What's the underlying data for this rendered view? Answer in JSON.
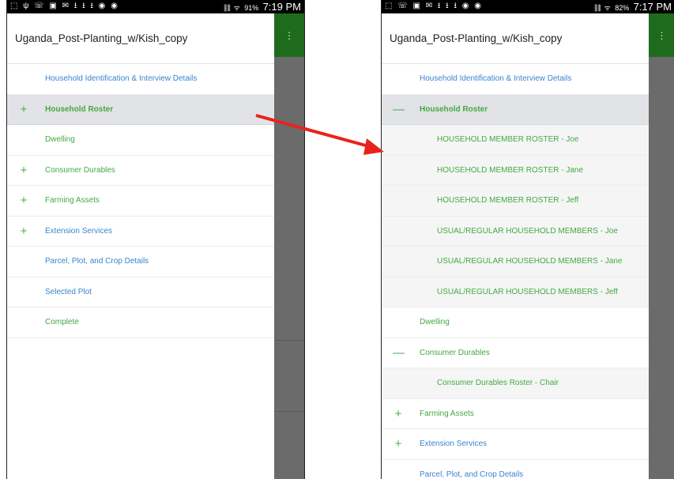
{
  "left_phone": {
    "status": {
      "icons": "⬚ ψ ☏ ▣ ✉ ⭳ ⭳ ⭳ ◉ ◉",
      "signal": "⛓ ᯤ",
      "battery_pct": "91%",
      "time": "7:19 PM"
    },
    "title": "Uganda_Post-Planting_w/Kish_copy",
    "items": [
      {
        "label": "Household Identification & Interview Details",
        "icon": "",
        "color": "blue"
      },
      {
        "label": "Household Roster",
        "icon": "+",
        "color": "green",
        "selected": true
      },
      {
        "label": "Dwelling",
        "icon": "",
        "color": "green"
      },
      {
        "label": "Consumer Durables",
        "icon": "+",
        "color": "green"
      },
      {
        "label": "Farming Assets",
        "icon": "+",
        "color": "green"
      },
      {
        "label": "Extension Services",
        "icon": "+",
        "color": "blue"
      },
      {
        "label": "Parcel, Plot, and Crop Details",
        "icon": "",
        "color": "blue"
      },
      {
        "label": "Selected Plot",
        "icon": "",
        "color": "blue"
      },
      {
        "label": "Complete",
        "icon": "",
        "color": "green"
      }
    ]
  },
  "right_phone": {
    "status": {
      "icons": "⬚ ☏ ▣ ✉ ⭳ ⭳ ⭳ ◉ ◉",
      "signal": "⛓ ᯤ",
      "battery_pct": "82%",
      "time": "7:17 PM"
    },
    "title": "Uganda_Post-Planting_w/Kish_copy",
    "items": [
      {
        "label": "Household Identification & Interview Details",
        "icon": "",
        "color": "blue"
      },
      {
        "label": "Household Roster",
        "icon": "—",
        "color": "green",
        "selected": true
      },
      {
        "label": "HOUSEHOLD MEMBER ROSTER - Joe",
        "icon": "",
        "color": "green",
        "child": true
      },
      {
        "label": "HOUSEHOLD MEMBER ROSTER - Jane",
        "icon": "",
        "color": "green",
        "child": true
      },
      {
        "label": "HOUSEHOLD MEMBER ROSTER - Jeff",
        "icon": "",
        "color": "green",
        "child": true
      },
      {
        "label": "USUAL/REGULAR  HOUSEHOLD MEMBERS - Joe",
        "icon": "",
        "color": "green",
        "child": true
      },
      {
        "label": "USUAL/REGULAR  HOUSEHOLD MEMBERS - Jane",
        "icon": "",
        "color": "green",
        "child": true
      },
      {
        "label": "USUAL/REGULAR  HOUSEHOLD MEMBERS - Jeff",
        "icon": "",
        "color": "green",
        "child": true
      },
      {
        "label": "Dwelling",
        "icon": "",
        "color": "green"
      },
      {
        "label": "Consumer Durables",
        "icon": "—",
        "color": "green"
      },
      {
        "label": "Consumer Durables Roster - Chair",
        "icon": "",
        "color": "green",
        "child": true
      },
      {
        "label": "Farming Assets",
        "icon": "+",
        "color": "green"
      },
      {
        "label": "Extension Services",
        "icon": "+",
        "color": "blue"
      },
      {
        "label": "Parcel, Plot, and Crop Details",
        "icon": "",
        "color": "blue"
      }
    ]
  },
  "overflow_icon": "⋮",
  "arrow_color": "#e8231d"
}
